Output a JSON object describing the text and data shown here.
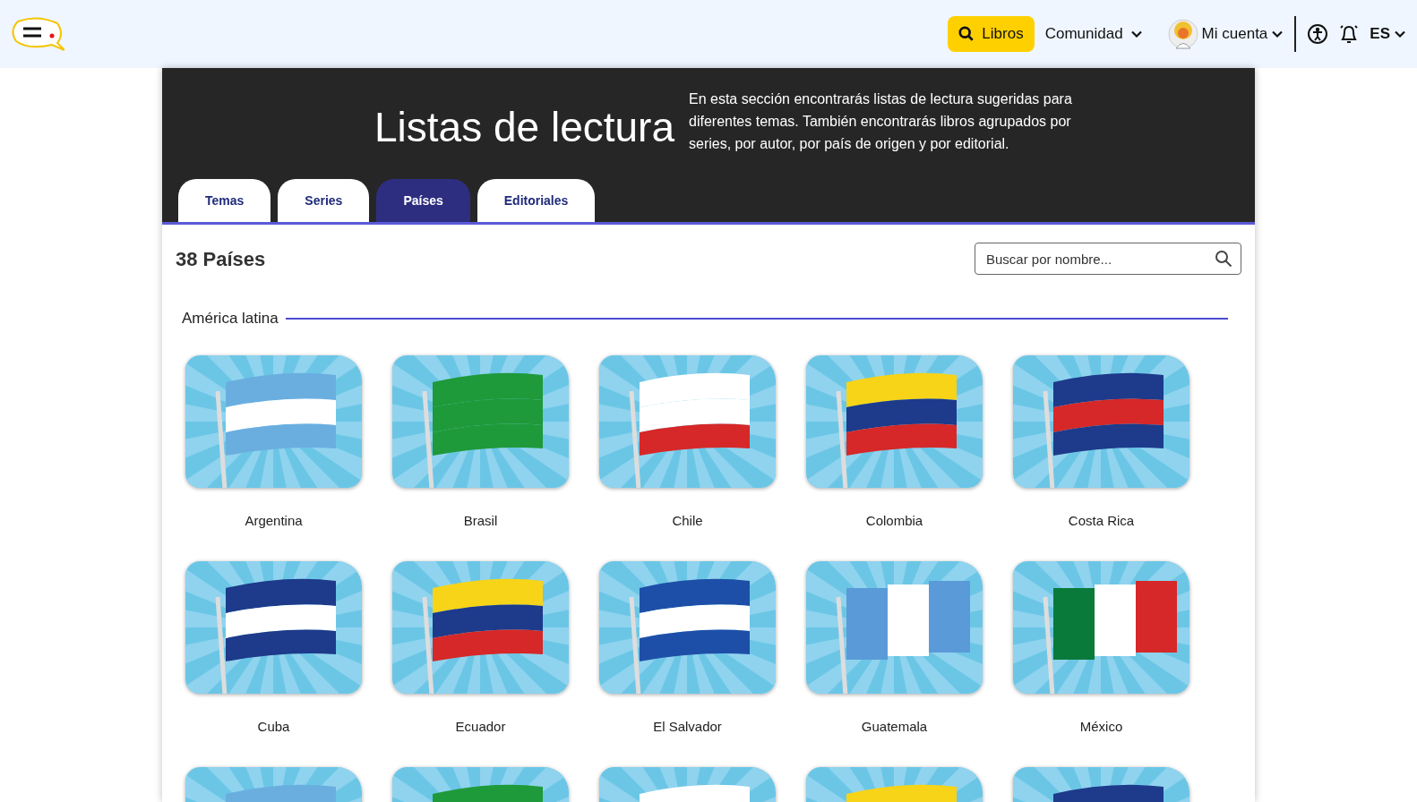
{
  "header": {
    "nav": [
      {
        "label": "Libros",
        "kind": "primary"
      },
      {
        "label": "Comunidad",
        "kind": "dropdown"
      },
      {
        "label": "Mi cuenta",
        "kind": "account"
      }
    ],
    "language": "ES"
  },
  "hero": {
    "title": "Listas de lectura",
    "description": "En esta sección encontrarás listas de lectura sugeridas para diferentes temas. También encontrarás libros agrupados por series, por autor, por país de origen y por editorial."
  },
  "tabs": [
    {
      "label": "Temas",
      "selected": false
    },
    {
      "label": "Series",
      "selected": false
    },
    {
      "label": "Países",
      "selected": true
    },
    {
      "label": "Editoriales",
      "selected": false
    }
  ],
  "count": "38 Países",
  "search": {
    "placeholder": "Buscar por nombre..."
  },
  "section": {
    "title": "América latina",
    "countries": [
      {
        "kind": "country",
        "name": "Argentina"
      },
      {
        "kind": "country",
        "name": "Brasil"
      },
      {
        "kind": "country",
        "name": "Chile"
      },
      {
        "kind": "country",
        "name": "Colombia"
      },
      {
        "kind": "country",
        "name": "Costa Rica"
      },
      {
        "kind": "country",
        "name": "Cuba"
      },
      {
        "kind": "country",
        "name": "Ecuador"
      },
      {
        "kind": "country",
        "name": "El Salvador"
      },
      {
        "kind": "country",
        "name": "Guatemala"
      },
      {
        "kind": "country",
        "name": "México"
      },
      {
        "kind": "picture"
      },
      {
        "kind": "picture"
      },
      {
        "kind": "picture"
      },
      {
        "kind": "picture"
      },
      {
        "kind": "picture"
      }
    ]
  }
}
